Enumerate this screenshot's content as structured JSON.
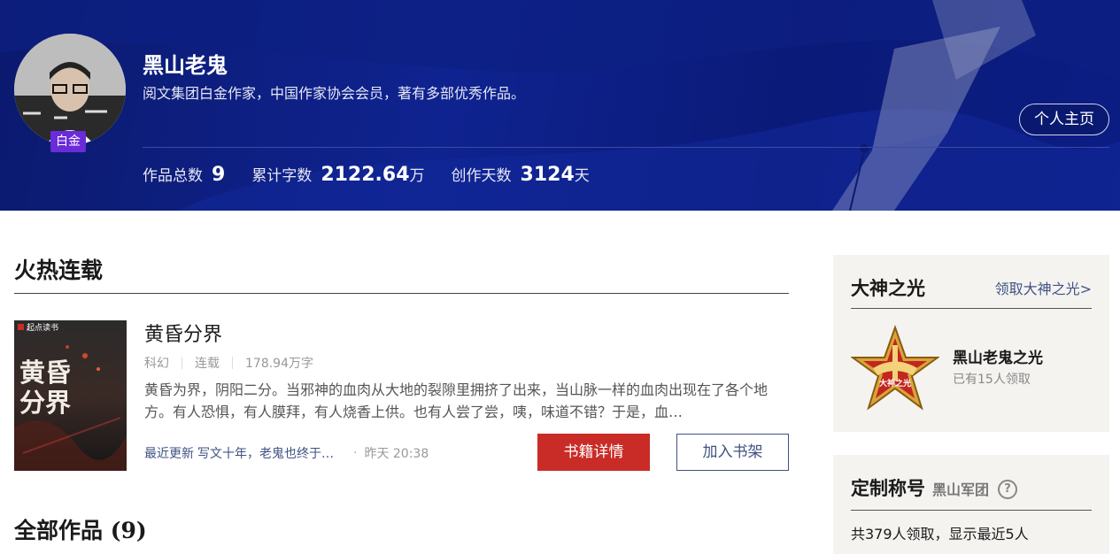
{
  "author": {
    "name": "黑山老鬼",
    "description": "阅文集团白金作家，中国作家协会会员，著有多部优秀作品。",
    "badge": "白金",
    "home_button": "个人主页"
  },
  "stats": [
    {
      "label": "作品总数",
      "value": "9",
      "unit": ""
    },
    {
      "label": "累计字数",
      "value": "2122.64",
      "unit": "万"
    },
    {
      "label": "创作天数",
      "value": "3124",
      "unit": "天"
    }
  ],
  "hot_section": {
    "title": "火热连载",
    "book": {
      "cover_brand": "起点读书",
      "cover_title": "黄昏分界",
      "title": "黄昏分界",
      "genre": "科幻",
      "status": "连载",
      "words": "178.94万字",
      "description": "黄昏为界，阴阳二分。当邪神的血肉从大地的裂隙里拥挤了出来，当山脉一样的血肉出现在了各个地方。有人恐惧，有人膜拜，有人烧香上供。也有人尝了尝，咦，味道不错？于是，血…",
      "latest_prefix": "最近更新",
      "latest_chapter": "写文十年，老鬼也终于…",
      "latest_time": "昨天 20:38",
      "detail_button": "书籍详情",
      "shelf_button": "加入书架"
    }
  },
  "all_works": {
    "title": "全部作品 (9)"
  },
  "glory": {
    "title": "大神之光",
    "link": "领取大神之光>",
    "badge_text": "大神之光",
    "name": "黑山老鬼之光",
    "count": "已有15人领取"
  },
  "custom_title": {
    "title": "定制称号",
    "name": "黑山军团",
    "help": "?",
    "count": "共379人领取，显示最近5人"
  },
  "colors": {
    "banner": "#0f2390",
    "badge": "#6a2bd9",
    "primary_red": "#c92c27",
    "link_blue": "#3f5282",
    "side_bg": "#f4f3f0"
  }
}
